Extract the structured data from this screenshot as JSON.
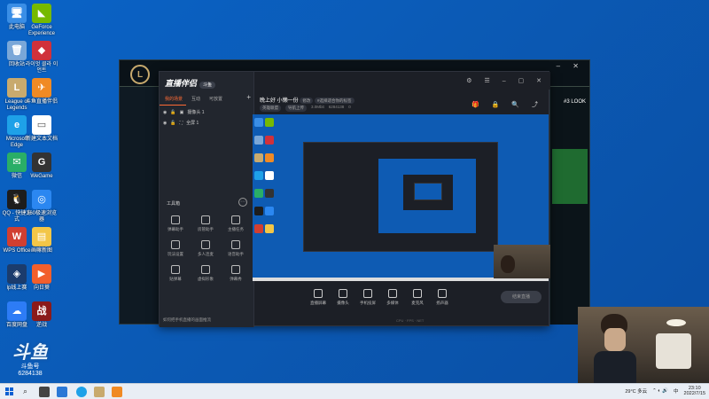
{
  "desktop_icons": [
    {
      "name": "computer",
      "label": "此电脑",
      "color": "#3a8ee6",
      "glyph": "🖥"
    },
    {
      "name": "geforce",
      "label": "GeForce Experience",
      "color": "#76b900",
      "glyph": "◣"
    },
    {
      "name": "recycle",
      "label": "回收站",
      "color": "#7aa7d8",
      "glyph": "🗑"
    },
    {
      "name": "kr-app",
      "label": "라이엇 클라 이언트",
      "color": "#d0313b",
      "glyph": "◆"
    },
    {
      "name": "lol",
      "label": "League of Legends",
      "color": "#c8aa6e",
      "glyph": "L"
    },
    {
      "name": "lol-cn",
      "label": "斗鱼直播伴侣",
      "color": "#f08a24",
      "glyph": "✈"
    },
    {
      "name": "edge",
      "label": "Microsoft Edge",
      "color": "#1ea1e8",
      "glyph": "e"
    },
    {
      "name": "newdoc",
      "label": "新建文本文档",
      "color": "#ffffff",
      "glyph": "▭"
    },
    {
      "name": "wechat",
      "label": "微信",
      "color": "#2aae67",
      "glyph": "✉"
    },
    {
      "name": "wegame",
      "label": "WeGame",
      "color": "#333333",
      "glyph": "G"
    },
    {
      "name": "qq",
      "label": "QQ - 快捷方式",
      "color": "#1d1d1d",
      "glyph": "🐧"
    },
    {
      "name": "browser360",
      "label": "360极速浏览器",
      "color": "#2b87f1",
      "glyph": "◎"
    },
    {
      "name": "wps",
      "label": "WPS Office",
      "color": "#d13f31",
      "glyph": "W"
    },
    {
      "name": "folder",
      "label": "画嘛新图",
      "color": "#f3c647",
      "glyph": "▤"
    },
    {
      "name": "lol-app2",
      "label": "lp线上赛",
      "color": "#1b3c6d",
      "glyph": "◈"
    },
    {
      "name": "yg",
      "label": "向日葵",
      "color": "#f25f2c",
      "glyph": "▶"
    },
    {
      "name": "baidunetdisk",
      "label": "百度网盘",
      "color": "#2d7cf6",
      "glyph": "☁"
    },
    {
      "name": "game",
      "label": "逆战",
      "color": "#8b1a1a",
      "glyph": "战"
    }
  ],
  "app": {
    "logo": "直播伴侣",
    "logo_tag": "斗鱼",
    "tabs": [
      "我的场景",
      "互动",
      "可放置"
    ],
    "scenes": [
      "摄像头 1",
      "全屏 1"
    ],
    "toolbox_title": "工具箱",
    "tools": [
      "弹幕助手",
      "房管助手",
      "主播任务",
      "玩法设置",
      "多人连麦",
      "语音助手",
      "贴弹幕",
      "虚拟形象",
      "弹幕秀"
    ],
    "tip": "如何把手机直播的画面推流",
    "title": "晚上好 小懒一份",
    "title_tag": "修改",
    "title_note": "#选择适合你的标签",
    "sub_badges": [
      "英雄联盟",
      "导航上传"
    ],
    "sub_stats": [
      "3.0Mbit",
      "6284138",
      "0"
    ],
    "bottom_tools": [
      "直播屏幕",
      "摄像头",
      "手机投屏",
      "多媒体",
      "麦克风",
      "扬声器"
    ],
    "go_live": "结束直播"
  },
  "overlay": {
    "douyu_big": "斗鱼",
    "douyu_sub": "斗鱼号",
    "room_id": "6284138",
    "lol_look": "#3 LOOK"
  },
  "taskbar": {
    "weather": "29°C 多云",
    "time": "23:10",
    "date": "2022/7/15",
    "ime": "中"
  }
}
